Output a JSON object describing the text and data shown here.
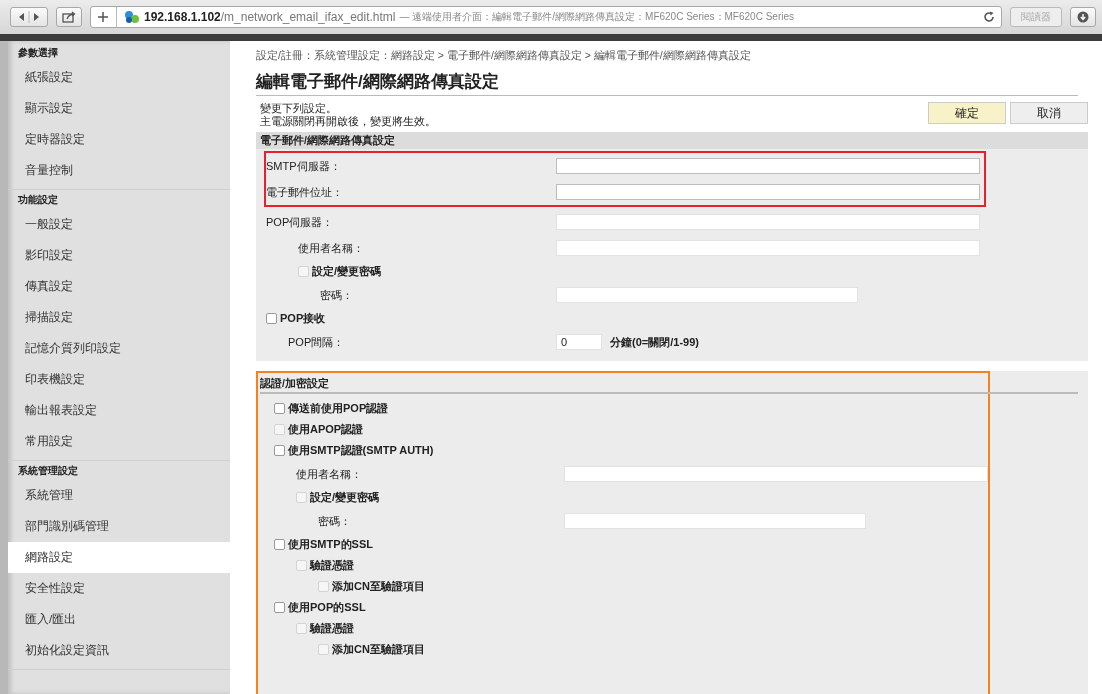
{
  "browser": {
    "url_host": "192.168.1.102",
    "url_path": "/m_network_email_ifax_edit.html",
    "page_title": "— 遠端使用者介面：編輯電子郵件/網際網路傳真設定：MF620C Series：MF620C Series",
    "reader_button": "閱讀器"
  },
  "sidebar": {
    "groups": [
      {
        "heading": "參數選擇",
        "items": [
          {
            "label": "紙張設定",
            "selected": false
          },
          {
            "label": "顯示設定",
            "selected": false
          },
          {
            "label": "定時器設定",
            "selected": false
          },
          {
            "label": "音量控制",
            "selected": false
          }
        ]
      },
      {
        "heading": "功能設定",
        "items": [
          {
            "label": "一般設定",
            "selected": false
          },
          {
            "label": "影印設定",
            "selected": false
          },
          {
            "label": "傳真設定",
            "selected": false
          },
          {
            "label": "掃描設定",
            "selected": false
          },
          {
            "label": "記憶介質列印設定",
            "selected": false
          },
          {
            "label": "印表機設定",
            "selected": false
          },
          {
            "label": "輸出報表設定",
            "selected": false
          },
          {
            "label": "常用設定",
            "selected": false
          }
        ]
      },
      {
        "heading": "系統管理設定",
        "items": [
          {
            "label": "系統管理",
            "selected": false
          },
          {
            "label": "部門識別碼管理",
            "selected": false
          },
          {
            "label": "網路設定",
            "selected": true
          },
          {
            "label": "安全性設定",
            "selected": false
          },
          {
            "label": "匯入/匯出",
            "selected": false
          },
          {
            "label": "初始化設定資訊",
            "selected": false
          }
        ]
      }
    ]
  },
  "breadcrumb": "設定/註冊：系統管理設定：網路設定 > 電子郵件/網際網路傳真設定 > 編輯電子郵件/網際網路傳真設定",
  "title": "編輯電子郵件/網際網路傳真設定",
  "description": [
    "變更下列設定。",
    "主電源關閉再開啟後，變更將生效。"
  ],
  "buttons": [
    {
      "label": "確定",
      "kind": "primary"
    },
    {
      "label": "取消",
      "kind": "secondary"
    }
  ],
  "sections": [
    {
      "heading": "電子郵件/網際網路傳真設定",
      "groups": [
        {
          "color": "#e8202a",
          "rows": [
            {
              "kind": "field",
              "label": "SMTP伺服器："
            },
            {
              "kind": "field",
              "label": "電子郵件位址："
            }
          ]
        },
        {
          "rows": [
            {
              "kind": "field",
              "label": "POP伺服器：",
              "children": [
                {
                  "kind": "field",
                  "label": "使用者名稱："
                },
                {
                  "kind": "checkbox",
                  "label": "設定/變更密碼",
                  "checked": false,
                  "disabled": true,
                  "children": [
                    {
                      "kind": "password",
                      "label": "密碼："
                    }
                  ]
                }
              ]
            },
            {
              "kind": "checkbox",
              "label": "POP接收",
              "checked": false,
              "disabled": false,
              "children": [
                {
                  "kind": "number",
                  "label": "POP間隔：",
                  "value": "0",
                  "suffix": "分鐘(0=關閉/1-99)"
                }
              ]
            }
          ]
        }
      ]
    },
    {
      "heading": "認證/加密設定",
      "color": "#f58220",
      "groups": [
        {
          "rows": [
            {
              "kind": "checkbox",
              "label": "傳送前使用POP認證",
              "checked": false,
              "disabled": false
            },
            {
              "kind": "checkbox",
              "label": "使用APOP認證",
              "checked": false,
              "disabled": true
            },
            {
              "kind": "checkbox",
              "label": "使用SMTP認證(SMTP AUTH)",
              "checked": false,
              "disabled": false,
              "children": [
                {
                  "kind": "field",
                  "label": "使用者名稱："
                },
                {
                  "kind": "checkbox",
                  "label": "設定/變更密碼",
                  "checked": false,
                  "disabled": true,
                  "children": [
                    {
                      "kind": "password",
                      "label": "密碼："
                    }
                  ]
                }
              ]
            },
            {
              "kind": "checkbox",
              "label": "使用SMTP的SSL",
              "checked": false,
              "disabled": false,
              "children": [
                {
                  "kind": "checkbox",
                  "label": "驗證憑證",
                  "checked": false,
                  "disabled": true,
                  "children": [
                    {
                      "kind": "checkbox",
                      "label": "添加CN至驗證項目",
                      "checked": false,
                      "disabled": true
                    }
                  ]
                }
              ]
            },
            {
              "kind": "checkbox",
              "label": "使用POP的SSL",
              "checked": false,
              "disabled": false,
              "children": [
                {
                  "kind": "checkbox",
                  "label": "驗證憑證",
                  "checked": false,
                  "disabled": true,
                  "children": [
                    {
                      "kind": "checkbox",
                      "label": "添加CN至驗證項目",
                      "checked": false,
                      "disabled": true
                    }
                  ]
                }
              ]
            }
          ]
        }
      ]
    }
  ]
}
